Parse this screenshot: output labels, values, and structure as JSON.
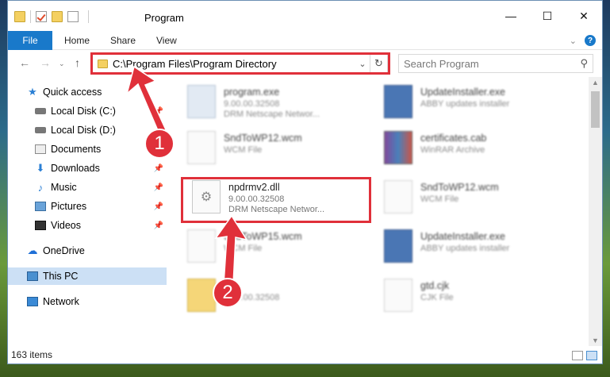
{
  "window": {
    "title": "Program",
    "buttons": {
      "minimize": "—",
      "maximize": "☐",
      "close": "✕"
    }
  },
  "ribbon": {
    "tabs": [
      "File",
      "Home",
      "Share",
      "View"
    ]
  },
  "address_bar": {
    "path": "C:\\Program Files\\Program Directory",
    "search_placeholder": "Search Program"
  },
  "sidebar": {
    "items": [
      {
        "label": "Quick access",
        "icon": "star-icon"
      },
      {
        "label": "Local Disk (C:)",
        "icon": "disk-icon"
      },
      {
        "label": "Local Disk (D:)",
        "icon": "disk-icon"
      },
      {
        "label": "Documents",
        "icon": "documents-icon"
      },
      {
        "label": "Downloads",
        "icon": "downloads-icon"
      },
      {
        "label": "Music",
        "icon": "music-icon"
      },
      {
        "label": "Pictures",
        "icon": "pictures-icon"
      },
      {
        "label": "Videos",
        "icon": "videos-icon"
      },
      {
        "label": "OneDrive",
        "icon": "onedrive-icon"
      },
      {
        "label": "This PC",
        "icon": "this-pc-icon"
      },
      {
        "label": "Network",
        "icon": "network-icon"
      }
    ]
  },
  "files": [
    {
      "name": "program.exe",
      "line1": "9.00.00.32508",
      "line2": "DRM Netscape Networ..."
    },
    {
      "name": "UpdateInstaller.exe",
      "line1": "ABBY updates installer",
      "line2": ""
    },
    {
      "name": "SndToWP12.wcm",
      "line1": "WCM File",
      "line2": ""
    },
    {
      "name": "certificates.cab",
      "line1": "WinRAR Archive",
      "line2": ""
    },
    {
      "name": "npdrmv2.dll",
      "line1": "9.00.00.32508",
      "line2": "DRM Netscape Networ..."
    },
    {
      "name": "SndToWP12.wcm",
      "line1": "WCM File",
      "line2": ""
    },
    {
      "name": "SndToWP15.wcm",
      "line1": "WCM File",
      "line2": ""
    },
    {
      "name": "UpdateInstaller.exe",
      "line1": "ABBY updates installer",
      "line2": ""
    },
    {
      "name": "",
      "line1": "9.00.00.32508",
      "line2": ""
    },
    {
      "name": "gtd.cjk",
      "line1": "CJK File",
      "line2": ""
    }
  ],
  "status": {
    "item_count": "163 items"
  },
  "annotations": {
    "step1": "1",
    "step2": "2"
  },
  "colors": {
    "accent": "#1979ca",
    "highlight": "#e0303a",
    "selected": "#cce0f5"
  }
}
